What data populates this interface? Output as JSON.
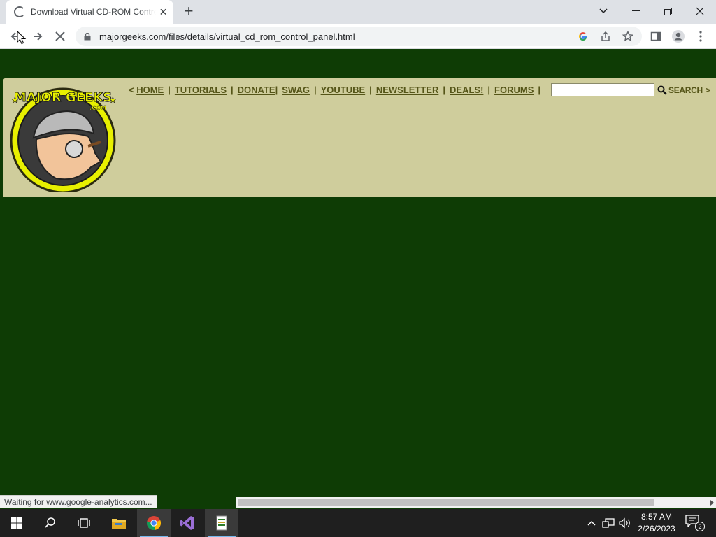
{
  "browser": {
    "tab": {
      "title": "Download Virtual CD-ROM Control Panel"
    },
    "address": {
      "url": "majorgeeks.com/files/details/virtual_cd_rom_control_panel.html"
    },
    "status_text": "Waiting for www.google-analytics.com..."
  },
  "site": {
    "logo": {
      "name": "MAJOR GEEKS",
      "sub": ".COM"
    },
    "nav": {
      "open": "<",
      "close": ">",
      "items": [
        {
          "label": "HOME"
        },
        {
          "label": "TUTORIALS"
        },
        {
          "label": "DONATE"
        },
        {
          "label": "SWAG"
        },
        {
          "label": "YOUTUBE"
        },
        {
          "label": "NEWSLETTER"
        },
        {
          "label": "DEALS!"
        },
        {
          "label": "FORUMS"
        }
      ]
    },
    "search": {
      "value": "",
      "button_label": "SEARCH"
    }
  },
  "taskbar": {
    "clock": {
      "time": "8:57 AM",
      "date": "2/26/2023"
    },
    "notification_count": "2",
    "apps": [
      "windows-start",
      "search",
      "task-view",
      "file-explorer",
      "chrome",
      "visual-studio",
      "notepad-app"
    ]
  },
  "colors": {
    "page_bg": "#0e3c05",
    "header_bg": "#cfcd9c",
    "nav_text": "#555518",
    "logo_yellow": "#e8f000"
  }
}
